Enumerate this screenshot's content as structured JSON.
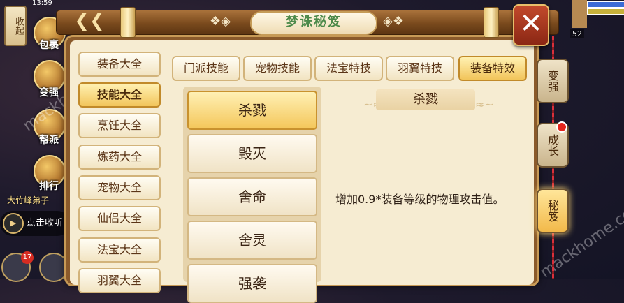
{
  "status_bar": {
    "time": "13:59"
  },
  "hud": {
    "collapse_label": "收起",
    "left_icons": [
      {
        "label": "包裹"
      },
      {
        "label": "变强"
      },
      {
        "label": "帮派"
      },
      {
        "label": "排行"
      }
    ],
    "chat_sender": "大竹峰弟子",
    "chat_button": "点击收听",
    "badge_count": "17",
    "level": "52"
  },
  "panel": {
    "title": "梦诛秘笈",
    "back_icon": "back-arrow-icon",
    "close_icon": "close-icon"
  },
  "categories": [
    {
      "label": "装备大全"
    },
    {
      "label": "技能大全"
    },
    {
      "label": "烹饪大全"
    },
    {
      "label": "炼药大全"
    },
    {
      "label": "宠物大全"
    },
    {
      "label": "仙侣大全"
    },
    {
      "label": "法宝大全"
    },
    {
      "label": "羽翼大全"
    }
  ],
  "active_category": "技能大全",
  "tabs": [
    {
      "label": "门派技能"
    },
    {
      "label": "宠物技能"
    },
    {
      "label": "法宝特技"
    },
    {
      "label": "羽翼特技"
    },
    {
      "label": "装备特效"
    }
  ],
  "active_tab": "装备特效",
  "skills": [
    {
      "label": "杀戮"
    },
    {
      "label": "毁灭"
    },
    {
      "label": "舍命"
    },
    {
      "label": "舍灵"
    },
    {
      "label": "强袭"
    }
  ],
  "detail": {
    "title": "杀戮",
    "description": "增加0.9*装备等级的物理攻击值。"
  },
  "side_buttons": [
    {
      "label": "变强"
    },
    {
      "label": "成长"
    },
    {
      "label": "秘笈"
    }
  ],
  "colors": {
    "accent_gold": "#f2c55b",
    "panel_bg": "#f6ecd2",
    "title_green": "#4d8a4a",
    "close_red": "#c24a2c"
  }
}
